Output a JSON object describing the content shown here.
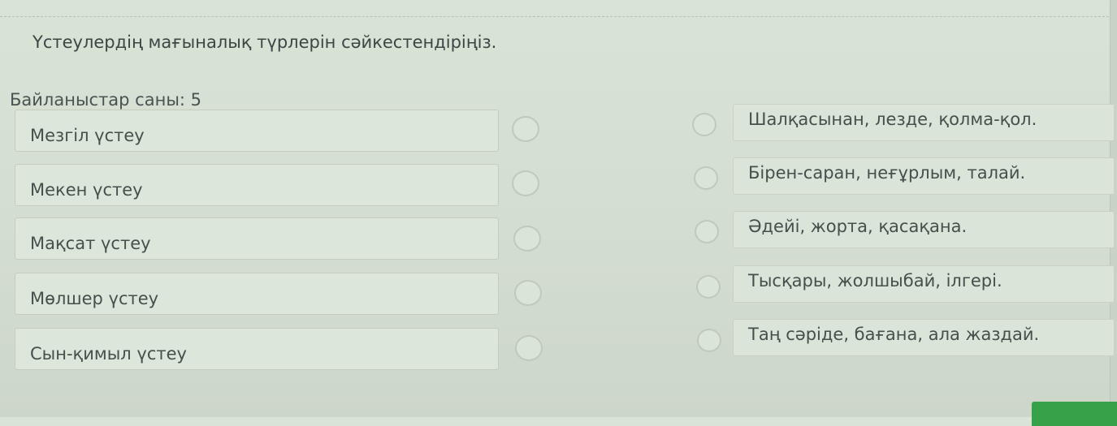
{
  "question": {
    "text": "Үстеулердің мағыналық түрлерін сәйкестендіріңіз."
  },
  "connections": {
    "text": "Байланыстар саны: 5"
  },
  "left_items": [
    {
      "label": "Мезгіл үстеу"
    },
    {
      "label": "Мекен үстеу"
    },
    {
      "label": "Мақсат үстеу"
    },
    {
      "label": "Мөлшер үстеу"
    },
    {
      "label": "Сын-қимыл үстеу"
    }
  ],
  "right_items": [
    {
      "label": "Шалқасынан, лезде, қолма-қол."
    },
    {
      "label": "Бірен-саран, неғұрлым, талай."
    },
    {
      "label": "Әдейі, жорта, қасақана."
    },
    {
      "label": "Тысқары, жолшыбай, ілгері."
    },
    {
      "label": "Таң сәріде, бағана, ала жаздай."
    }
  ],
  "colors": {
    "background": "#d5dfd2",
    "submit_button": "#37a14a"
  }
}
